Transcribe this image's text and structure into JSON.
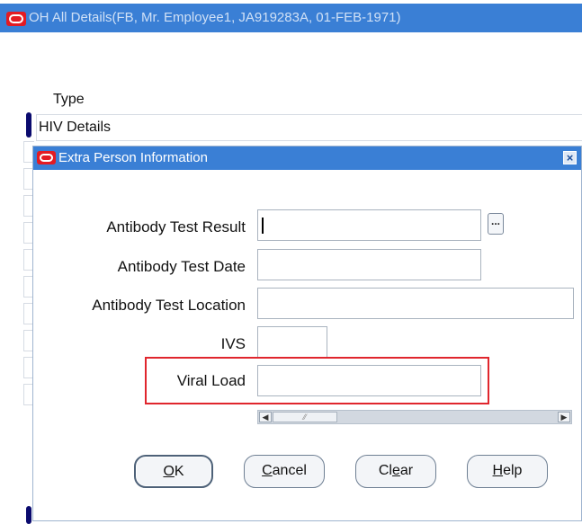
{
  "outer_window": {
    "title": "OH All Details(FB, Mr. Employee1, JA919283A, 01-FEB-1971)"
  },
  "type_column": {
    "header": "Type",
    "selected_row": "HIV Details"
  },
  "dialog": {
    "title": "Extra Person Information",
    "fields": {
      "antibody_test_result": {
        "label": "Antibody Test Result",
        "value": ""
      },
      "antibody_test_date": {
        "label": "Antibody Test Date",
        "value": ""
      },
      "antibody_test_location": {
        "label": "Antibody Test Location",
        "value": ""
      },
      "ivs": {
        "label": "IVS",
        "value": ""
      },
      "viral_load": {
        "label": "Viral Load",
        "value": ""
      }
    },
    "lov_button": "...",
    "buttons": {
      "ok_mnemonic": "O",
      "ok_rest": "K",
      "cancel_mnemonic": "C",
      "cancel_rest": "ancel",
      "clear_pre": "Cl",
      "clear_mnemonic": "e",
      "clear_rest": "ar",
      "help_mnemonic": "H",
      "help_rest": "elp"
    }
  },
  "colors": {
    "title_bar": "#3a7fd5",
    "highlight": "#e0262d",
    "oracle_logo": "#e31b23"
  },
  "icons": {
    "close": "close-icon",
    "lov": "ellipsis-icon",
    "scroll_left": "arrow-left-icon",
    "scroll_right": "arrow-right-icon"
  }
}
